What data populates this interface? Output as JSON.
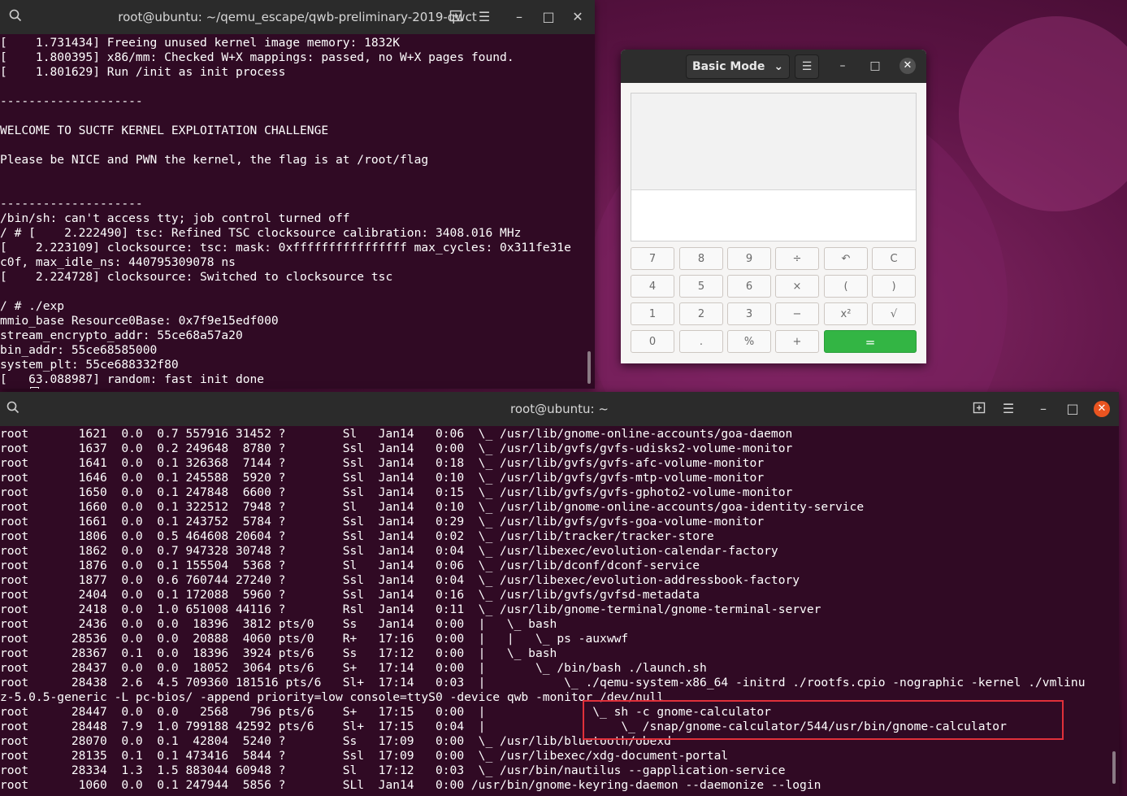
{
  "colors": {
    "terminal_bg": "#300a24",
    "titlebar_bg": "#2b2b2b",
    "terminal_text": "#ffffff",
    "calc_equals": "#33b544",
    "close_red": "#e95420",
    "highlight": "#e0303a"
  },
  "top_terminal": {
    "title": "root@ubuntu: ~/qemu_escape/qwb-preliminary-2019-qwct",
    "icons": [
      "search-icon",
      "new-tab-icon",
      "menu-icon",
      "minimize-icon",
      "maximize-icon",
      "close-icon"
    ],
    "lines": [
      "[    1.731434] Freeing unused kernel image memory: 1832K",
      "[    1.800395] x86/mm: Checked W+X mappings: passed, no W+X pages found.",
      "[    1.801629] Run /init as init process",
      "",
      "--------------------",
      "",
      "WELCOME TO SUCTF KERNEL EXPLOITATION CHALLENGE",
      "",
      "Please be NICE and PWN the kernel, the flag is at /root/flag",
      "",
      "",
      "--------------------",
      "/bin/sh: can't access tty; job control turned off",
      "/ # [    2.222490] tsc: Refined TSC clocksource calibration: 3408.016 MHz",
      "[    2.223109] clocksource: tsc: mask: 0xffffffffffffffff max_cycles: 0x311fe31e",
      "c0f, max_idle_ns: 440795309078 ns",
      "[    2.224728] clocksource: Switched to clocksource tsc",
      "",
      "/ # ./exp",
      "mmio_base Resource0Base: 0x7f9e15edf000",
      "stream_encrypto_addr: 55ce68a57a20",
      "bin_addr: 55ce68585000",
      "system_plt: 55ce688332f80",
      "[   63.088987] random: fast init done",
      "/ # "
    ]
  },
  "calculator": {
    "mode_label": "Basic Mode",
    "mode_chevron": "⌄",
    "menu_icon": "☰",
    "minimize": "–",
    "maximize": "□",
    "close": "✕",
    "keys": [
      [
        "7",
        "8",
        "9",
        "÷",
        "↶",
        "C"
      ],
      [
        "4",
        "5",
        "6",
        "×",
        "(",
        ")"
      ],
      [
        "1",
        "2",
        "3",
        "−",
        "x²",
        "√"
      ],
      [
        "0",
        ".",
        "%",
        "+",
        "="
      ]
    ]
  },
  "bottom_terminal": {
    "title": "root@ubuntu: ~",
    "lines": [
      "root       1621  0.0  0.7 557916 31452 ?        Sl   Jan14   0:06  \\_ /usr/lib/gnome-online-accounts/goa-daemon",
      "root       1637  0.0  0.2 249648  8780 ?        Ssl  Jan14   0:00  \\_ /usr/lib/gvfs/gvfs-udisks2-volume-monitor",
      "root       1641  0.0  0.1 326368  7144 ?        Ssl  Jan14   0:18  \\_ /usr/lib/gvfs/gvfs-afc-volume-monitor",
      "root       1646  0.0  0.1 245588  5920 ?        Ssl  Jan14   0:10  \\_ /usr/lib/gvfs/gvfs-mtp-volume-monitor",
      "root       1650  0.0  0.1 247848  6600 ?        Ssl  Jan14   0:15  \\_ /usr/lib/gvfs/gvfs-gphoto2-volume-monitor",
      "root       1660  0.0  0.1 322512  7948 ?        Sl   Jan14   0:10  \\_ /usr/lib/gnome-online-accounts/goa-identity-service",
      "root       1661  0.0  0.1 243752  5784 ?        Ssl  Jan14   0:29  \\_ /usr/lib/gvfs/gvfs-goa-volume-monitor",
      "root       1806  0.0  0.5 464608 20604 ?        Ssl  Jan14   0:02  \\_ /usr/lib/tracker/tracker-store",
      "root       1862  0.0  0.7 947328 30748 ?        Ssl  Jan14   0:04  \\_ /usr/libexec/evolution-calendar-factory",
      "root       1876  0.0  0.1 155504  5368 ?        Sl   Jan14   0:06  \\_ /usr/lib/dconf/dconf-service",
      "root       1877  0.0  0.6 760744 27240 ?        Ssl  Jan14   0:04  \\_ /usr/libexec/evolution-addressbook-factory",
      "root       2404  0.0  0.1 172088  5960 ?        Ssl  Jan14   0:16  \\_ /usr/lib/gvfs/gvfsd-metadata",
      "root       2418  0.0  1.0 651008 44116 ?        Rsl  Jan14   0:11  \\_ /usr/lib/gnome-terminal/gnome-terminal-server",
      "root       2436  0.0  0.0  18396  3812 pts/0    Ss   Jan14   0:00  |   \\_ bash",
      "root      28536  0.0  0.0  20888  4060 pts/0    R+   17:16   0:00  |   |   \\_ ps -auxwwf",
      "root      28367  0.1  0.0  18396  3924 pts/6    Ss   17:12   0:00  |   \\_ bash",
      "root      28437  0.0  0.0  18052  3064 pts/6    S+   17:14   0:00  |       \\_ /bin/bash ./launch.sh",
      "root      28438  2.6  4.5 709360 181516 pts/6   Sl+  17:14   0:03  |           \\_ ./qemu-system-x86_64 -initrd ./rootfs.cpio -nographic -kernel ./vmlinu",
      "z-5.0.5-generic -L pc-bios/ -append priority=low console=ttyS0 -device qwb -monitor /dev/null",
      "root      28447  0.0  0.0   2568   796 pts/6    S+   17:15   0:00  |               \\_ sh -c gnome-calculator",
      "root      28448  7.9  1.0 799188 42592 pts/6    Sl+  17:15   0:04  |                   \\_ /snap/gnome-calculator/544/usr/bin/gnome-calculator",
      "root      28070  0.0  0.1  42804  5240 ?        Ss   17:09   0:00  \\_ /usr/lib/bluetooth/obexd",
      "root      28135  0.1  0.1 473416  5844 ?        Ssl  17:09   0:00  \\_ /usr/libexec/xdg-document-portal",
      "root      28334  1.3  1.5 883044 60948 ?        Sl   17:12   0:03  \\_ /usr/bin/nautilus --gapplication-service",
      "root       1060  0.0  0.1 247944  5856 ?        SLl  Jan14   0:00 /usr/bin/gnome-keyring-daemon --daemonize --login"
    ]
  }
}
